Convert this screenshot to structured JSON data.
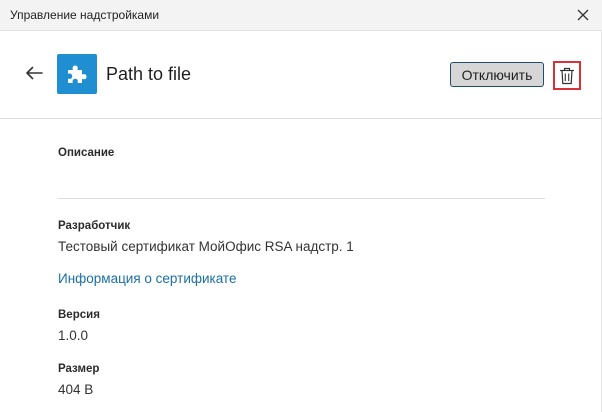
{
  "window": {
    "title": "Управление надстройками"
  },
  "header": {
    "addin_name": "Path to file",
    "disable_label": "Отключить"
  },
  "details": {
    "description_label": "Описание",
    "developer_label": "Разработчик",
    "developer_value": "Тестовый сертификат МойОфис RSA надстр. 1",
    "certificate_link": "Информация о сертификате",
    "version_label": "Версия",
    "version_value": "1.0.0",
    "size_label": "Размер",
    "size_value": "404 B"
  },
  "colors": {
    "accent": "#1f8fd1",
    "link": "#1a6fa8",
    "delete_highlight": "#d9303a"
  },
  "icons": {
    "close": "close-icon",
    "back": "arrow-left-icon",
    "addin": "puzzle-piece-icon",
    "delete": "trash-icon"
  }
}
